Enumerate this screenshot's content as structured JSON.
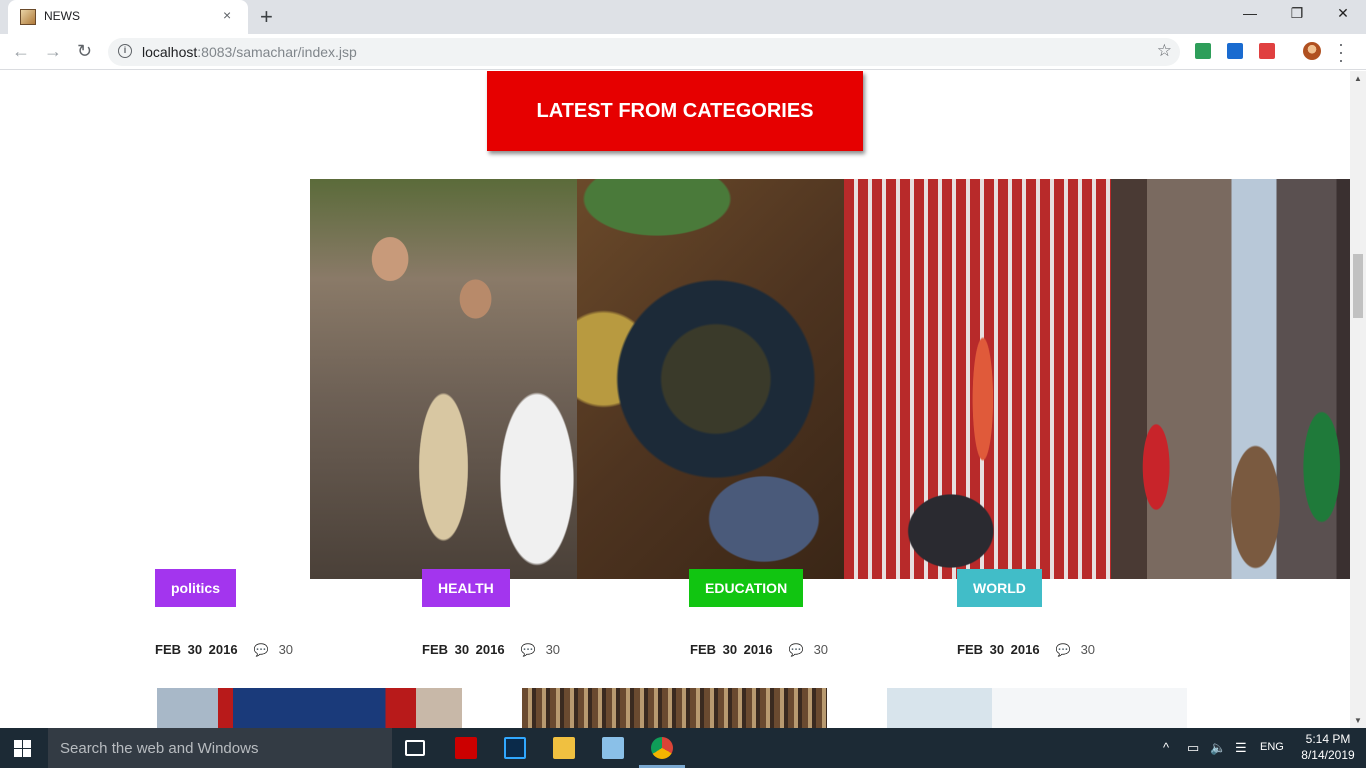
{
  "browser": {
    "tab_title": "NEWS",
    "tab_close": "×",
    "new_tab": "+",
    "url_host": "localhost",
    "url_rest": ":8083/samachar/index.jsp",
    "window_controls": {
      "minimize": "—",
      "restore": "❐",
      "close": "✕"
    }
  },
  "section": {
    "title": "LATEST FROM CATEGORIES"
  },
  "cards": [
    {
      "category": "politics",
      "badge_color": "#a335ee",
      "date": "FEB 30 2016",
      "comments": "30"
    },
    {
      "category": "HEALTH",
      "badge_color": "#a335ee",
      "date": "FEB 30 2016",
      "comments": "30"
    },
    {
      "category": "EDUCATION",
      "badge_color": "#11c511",
      "date": "FEB 30 2016",
      "comments": "30"
    },
    {
      "category": "WORLD",
      "badge_color": "#41bdc8",
      "date": "FEB 30 2016",
      "comments": "30"
    }
  ],
  "taskbar": {
    "search_placeholder": "Search the web and Windows",
    "language": "ENG",
    "time": "5:14 PM",
    "date": "8/14/2019"
  },
  "colors": {
    "header_red": "#e60000",
    "taskbar": "#1c2a35"
  }
}
